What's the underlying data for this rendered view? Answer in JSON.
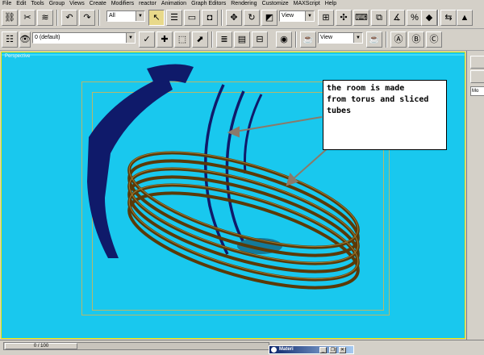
{
  "menu": [
    "File",
    "Edit",
    "Tools",
    "Group",
    "Views",
    "Create",
    "Modifiers",
    "reactor",
    "Animation",
    "Graph Editors",
    "Rendering",
    "Customize",
    "MAXScript",
    "Help"
  ],
  "toolbar1": {
    "selection_filter": "All",
    "reference_coord": "View"
  },
  "toolbar2": {
    "layer_name": "0 (default)",
    "render_view": "View"
  },
  "viewport": {
    "label": "Perspective",
    "background_color": "#19c8ee",
    "annotation": "the room is made\nfrom torus and sliced\ntubes"
  },
  "command_panel": {
    "field_label": "Mo"
  },
  "timebar": {
    "frame_label": "0 / 100"
  },
  "mini_window": {
    "title": "Materi"
  }
}
